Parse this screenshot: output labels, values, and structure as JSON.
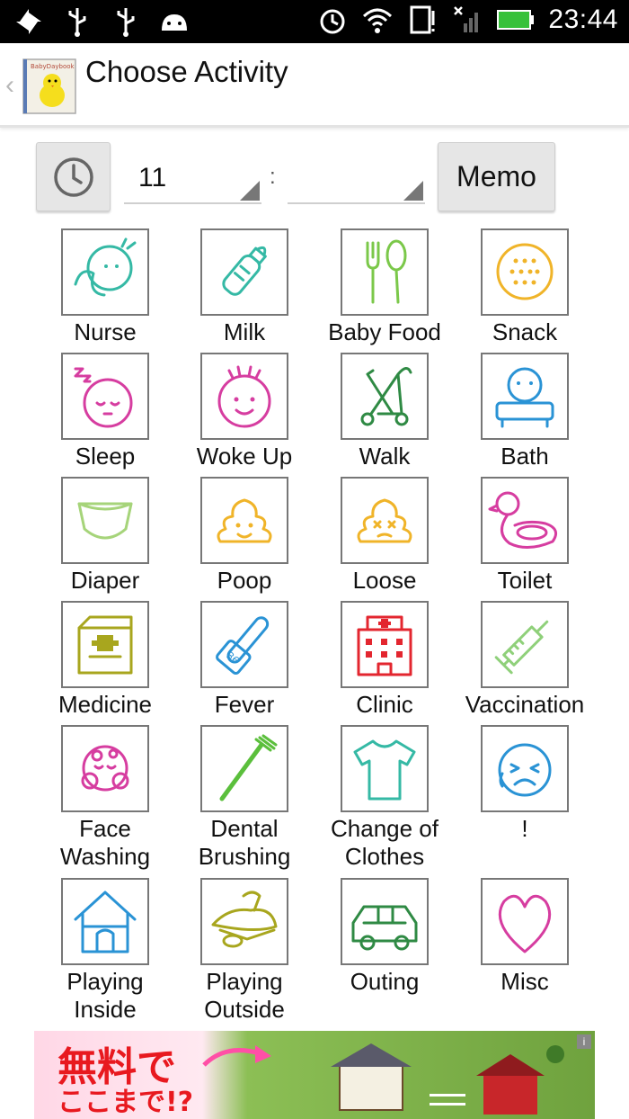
{
  "status_bar": {
    "time": "23:44"
  },
  "action_bar": {
    "title": "Choose Activity",
    "app_icon_label": "BabyDaybook"
  },
  "time_picker": {
    "hour": "11",
    "separator": ":",
    "minute": "",
    "memo_label": "Memo"
  },
  "activities": [
    {
      "label": "Nurse",
      "icon": "nurse-icon",
      "color": "#35b9a5"
    },
    {
      "label": "Milk",
      "icon": "milk-bottle-icon",
      "color": "#35b9a5"
    },
    {
      "label": "Baby Food",
      "icon": "fork-spoon-icon",
      "color": "#7bc84a"
    },
    {
      "label": "Snack",
      "icon": "cookie-icon",
      "color": "#f0b429"
    },
    {
      "label": "Sleep",
      "icon": "sleep-icon",
      "color": "#d63da0"
    },
    {
      "label": "Woke Up",
      "icon": "woke-up-icon",
      "color": "#d63da0"
    },
    {
      "label": "Walk",
      "icon": "stroller-icon",
      "color": "#2f8a44"
    },
    {
      "label": "Bath",
      "icon": "bath-icon",
      "color": "#2a93d5"
    },
    {
      "label": "Diaper",
      "icon": "diaper-icon",
      "color": "#a6d47a"
    },
    {
      "label": "Poop",
      "icon": "poop-icon",
      "color": "#f0b429"
    },
    {
      "label": "Loose",
      "icon": "loose-poop-icon",
      "color": "#f0b429"
    },
    {
      "label": "Toilet",
      "icon": "duck-potty-icon",
      "color": "#d63da0"
    },
    {
      "label": "Medicine",
      "icon": "medicine-box-icon",
      "color": "#a8a61e"
    },
    {
      "label": "Fever",
      "icon": "thermometer-icon",
      "color": "#2a93d5"
    },
    {
      "label": "Clinic",
      "icon": "hospital-icon",
      "color": "#e3262f"
    },
    {
      "label": "Vaccination",
      "icon": "syringe-icon",
      "color": "#8fd07a"
    },
    {
      "label": "Face\nWashing",
      "icon": "face-washing-icon",
      "color": "#d63da0"
    },
    {
      "label": "Dental\nBrushing",
      "icon": "toothbrush-icon",
      "color": "#5bbf3c"
    },
    {
      "label": "Change of\nClothes",
      "icon": "tshirt-icon",
      "color": "#35b9a5"
    },
    {
      "label": "!",
      "icon": "crying-face-icon",
      "color": "#2a93d5"
    },
    {
      "label": "Playing\nInside",
      "icon": "house-icon",
      "color": "#2a93d5"
    },
    {
      "label": "Playing\nOutside",
      "icon": "sandbox-icon",
      "color": "#a8a61e"
    },
    {
      "label": "Outing",
      "icon": "car-icon",
      "color": "#2f8a44"
    },
    {
      "label": "Misc",
      "icon": "heart-icon",
      "color": "#d63da0"
    }
  ],
  "ad": {
    "text_line1": "無料で",
    "text_line2": "ここまで!?"
  }
}
